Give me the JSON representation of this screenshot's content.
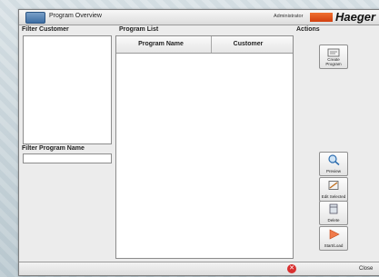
{
  "window": {
    "title": "Program Overview",
    "user": "Administrator",
    "brand": "Haeger"
  },
  "filter_customer": {
    "label": "Filter Customer"
  },
  "filter_program": {
    "label": "Filter Program Name",
    "value": ""
  },
  "program_list": {
    "label": "Program List",
    "columns": [
      "Program Name",
      "Customer"
    ],
    "rows": []
  },
  "actions": {
    "label": "Actions",
    "create": "Create Program",
    "preview": "Preview",
    "edit": "Edit Selected",
    "delete": "Delete",
    "start": "Start/Load"
  },
  "footer": {
    "close_label": "Close"
  },
  "colors": {
    "brand_accent": "#e4561c",
    "close_red": "#d93030"
  }
}
